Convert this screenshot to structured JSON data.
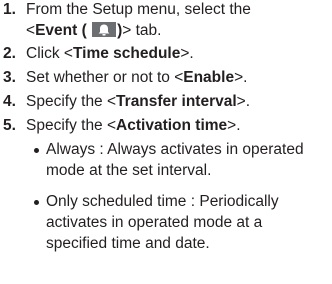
{
  "steps": [
    {
      "num": "1.",
      "line1": "From the Setup menu, select the",
      "line2_pre": "<",
      "line2_bold": "Event (",
      "line2_bold2": ")",
      "line2_post": "> tab.",
      "icon": "event-bell-icon"
    },
    {
      "num": "2.",
      "pre": "Click <",
      "bold": "Time schedule",
      "post": ">."
    },
    {
      "num": "3.",
      "pre": "Set whether or not to <",
      "bold": "Enable",
      "post": ">."
    },
    {
      "num": "4.",
      "pre": "Specify the <",
      "bold": "Transfer interval",
      "post": ">."
    },
    {
      "num": "5.",
      "pre": "Specify the <",
      "bold": "Activation time",
      "post": ">."
    }
  ],
  "bullets": [
    {
      "line1": "Always : Always activates in operated",
      "line2": "mode at the set interval."
    },
    {
      "line1": "Only scheduled time : Periodically",
      "line2": "activates in operated mode at a",
      "line3": "specified time and date."
    }
  ]
}
